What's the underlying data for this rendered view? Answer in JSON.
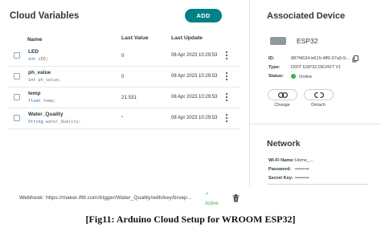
{
  "cloud_variables": {
    "title": "Cloud Variables",
    "add_label": "ADD",
    "columns": {
      "name": "Name",
      "sort_arrow": "↓",
      "last_value": "Last Value",
      "last_update": "Last Update"
    },
    "rows": [
      {
        "name": "LED",
        "type_kw": "int",
        "type_rest": "LED;",
        "value": "0",
        "updated": "08 Apr 2023 10:29:53"
      },
      {
        "name": "ph_value",
        "type_kw": "int",
        "type_rest": "ph_value;",
        "value": "0",
        "updated": "08 Apr 2023 10:29:53"
      },
      {
        "name": "temp",
        "type_kw": "float",
        "type_rest": "temp;",
        "value": "21.531",
        "updated": "08 Apr 2023 10:29:53"
      },
      {
        "name": "Water_Quality",
        "type_kw": "String",
        "type_rest": "water_Quality;",
        "value": "\"",
        "updated": "08 Apr 2023 10:29:53"
      }
    ]
  },
  "associated_device": {
    "title": "Associated Device",
    "device_name": "ESP32",
    "id_label": "ID:",
    "id_value": "887f4634-b615-4ff0-97a9-9...",
    "type_label": "Type:",
    "type_value": "DOIT ESP32 DEVKIT V1",
    "status_label": "Status:",
    "status_value": "Online",
    "change_label": "Change",
    "detach_label": "Detach",
    "status_color": "#3fae49"
  },
  "network": {
    "title": "Network",
    "wifi_label": "Wi-Fi Name:",
    "wifi_value": "Home_...",
    "password_label": "Password:",
    "password_value": "•••••••••",
    "secret_label": "Secret Key:",
    "secret_value": "•••••••••"
  },
  "webhook": {
    "label": "Webhook:",
    "url": "https://maker.ifttt.com/trigger/Water_Quality/with/key/brvep...",
    "check": "✓",
    "status": "Active"
  },
  "caption": "[Fig11: Arduino Cloud Setup for WROOM ESP32]",
  "colors": {
    "accent": "#008184",
    "online": "#3fae49"
  }
}
